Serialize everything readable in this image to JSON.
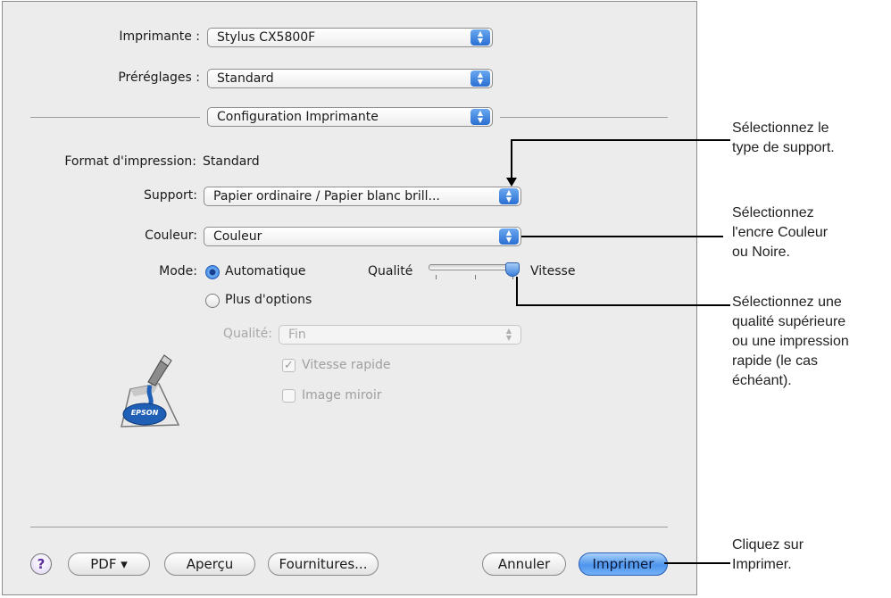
{
  "dialog": {
    "printer": {
      "label": "Imprimante :",
      "value": "Stylus CX5800F"
    },
    "presets": {
      "label": "Préréglages :",
      "value": "Standard"
    },
    "panel": {
      "value": "Configuration Imprimante"
    },
    "page_format": {
      "label": "Format d'impression:",
      "value": "Standard"
    },
    "media": {
      "label": "Support:",
      "value": "Papier ordinaire / Papier blanc brill..."
    },
    "color": {
      "label": "Couleur:",
      "value": "Couleur"
    },
    "mode": {
      "label": "Mode:",
      "automatic": "Automatique",
      "more_options": "Plus d'options",
      "quality_label": "Qualité",
      "speed_label": "Vitesse",
      "slider_level": 1.0
    },
    "quality": {
      "label": "Qualité:",
      "value": "Fin"
    },
    "fast_speed": {
      "label": "Vitesse rapide",
      "checked": true
    },
    "mirror_image": {
      "label": "Image miroir",
      "checked": false
    },
    "logo_text": "EPSON",
    "buttons": {
      "help": "?",
      "pdf": "PDF ▾",
      "preview": "Aperçu",
      "supplies": "Fournitures...",
      "cancel": "Annuler",
      "print": "Imprimer"
    }
  },
  "annotations": {
    "media": [
      "Sélectionnez le",
      "type de support."
    ],
    "color": [
      "Sélectionnez",
      "l'encre Couleur",
      "ou Noire."
    ],
    "quality": [
      "Sélectionnez une",
      "qualité supérieure",
      "ou une impression",
      "rapide (le cas",
      "échéant)."
    ],
    "print": [
      "Cliquez sur",
      "Imprimer."
    ]
  }
}
